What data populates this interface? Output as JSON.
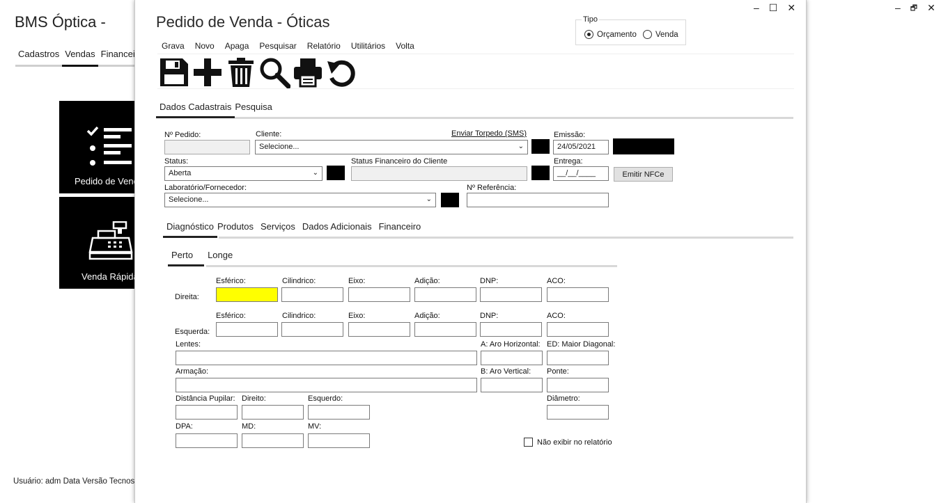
{
  "background": {
    "app_title": "BMS Óptica -",
    "nav": [
      "Cadastros",
      "Vendas",
      "Financei"
    ],
    "tiles": [
      {
        "label": "Pedido de Venc",
        "icon": "checklist-icon"
      },
      {
        "label": "Venda Rápida",
        "icon": "cash-register-icon"
      }
    ],
    "status_bar": "Usuário: adm  Data  Versão Tecnos",
    "window_controls": [
      "–",
      "🗗",
      "✕"
    ]
  },
  "modal": {
    "title": "Pedido de Venda - Óticas",
    "window_controls": [
      "–",
      "☐",
      "✕"
    ],
    "menu": [
      "Grava",
      "Novo",
      "Apaga",
      "Pesquisar",
      "Relatório",
      "Utilitários",
      "Volta"
    ],
    "toolbar_icons": [
      "save-icon",
      "add-icon",
      "trash-icon",
      "search-icon",
      "print-icon",
      "undo-icon"
    ],
    "tipo": {
      "legend": "Tipo",
      "options": [
        "Orçamento",
        "Venda"
      ],
      "selected": "Orçamento"
    },
    "main_tabs": [
      "Dados Cadastrais",
      "Pesquisa"
    ],
    "form": {
      "pedido_label": "Nº Pedido:",
      "pedido_value": "",
      "cliente_label": "Cliente:",
      "cliente_value": "Selecione...",
      "sms_link": "Enviar Torpedo (SMS)",
      "emissao_label": "Emissão:",
      "emissao_value": "24/05/2021",
      "status_label": "Status:",
      "status_value": "Aberta",
      "status_fin_label": "Status Financeiro do Cliente",
      "status_fin_value": "",
      "entrega_label": "Entrega:",
      "entrega_value": "__/__/____",
      "nfce_button": "Emitir NFCe",
      "lab_label": "Laboratório/Fornecedor:",
      "lab_value": "Selecione...",
      "ref_label": "Nº Referência:",
      "ref_value": ""
    },
    "sub_tabs": [
      "Diagnóstico",
      "Produtos",
      "Serviços",
      "Dados Adicionais",
      "Financeiro"
    ],
    "inner_tabs": [
      "Perto",
      "Longe"
    ],
    "diag": {
      "cols": [
        "Esférico:",
        "Cilindrico:",
        "Eixo:",
        "Adição:",
        "DNP:",
        "ACO:"
      ],
      "direita": "Direita:",
      "esquerda": "Esquerda:",
      "lentes": "Lentes:",
      "aro_h": "A: Aro Horizontal:",
      "ed": "ED: Maior Diagonal:",
      "armacao": "Armação:",
      "aro_v": "B: Aro Vertical:",
      "ponte": "Ponte:",
      "dist_pupilar": "Distância Pupilar:",
      "direito": "Direito:",
      "esquerdo": "Esquerdo:",
      "diametro": "Diâmetro:",
      "dpa": "DPA:",
      "md": "MD:",
      "mv": "MV:",
      "nao_exibir": "Não exibir no relatório"
    },
    "highlight_color": "#ffff00"
  }
}
